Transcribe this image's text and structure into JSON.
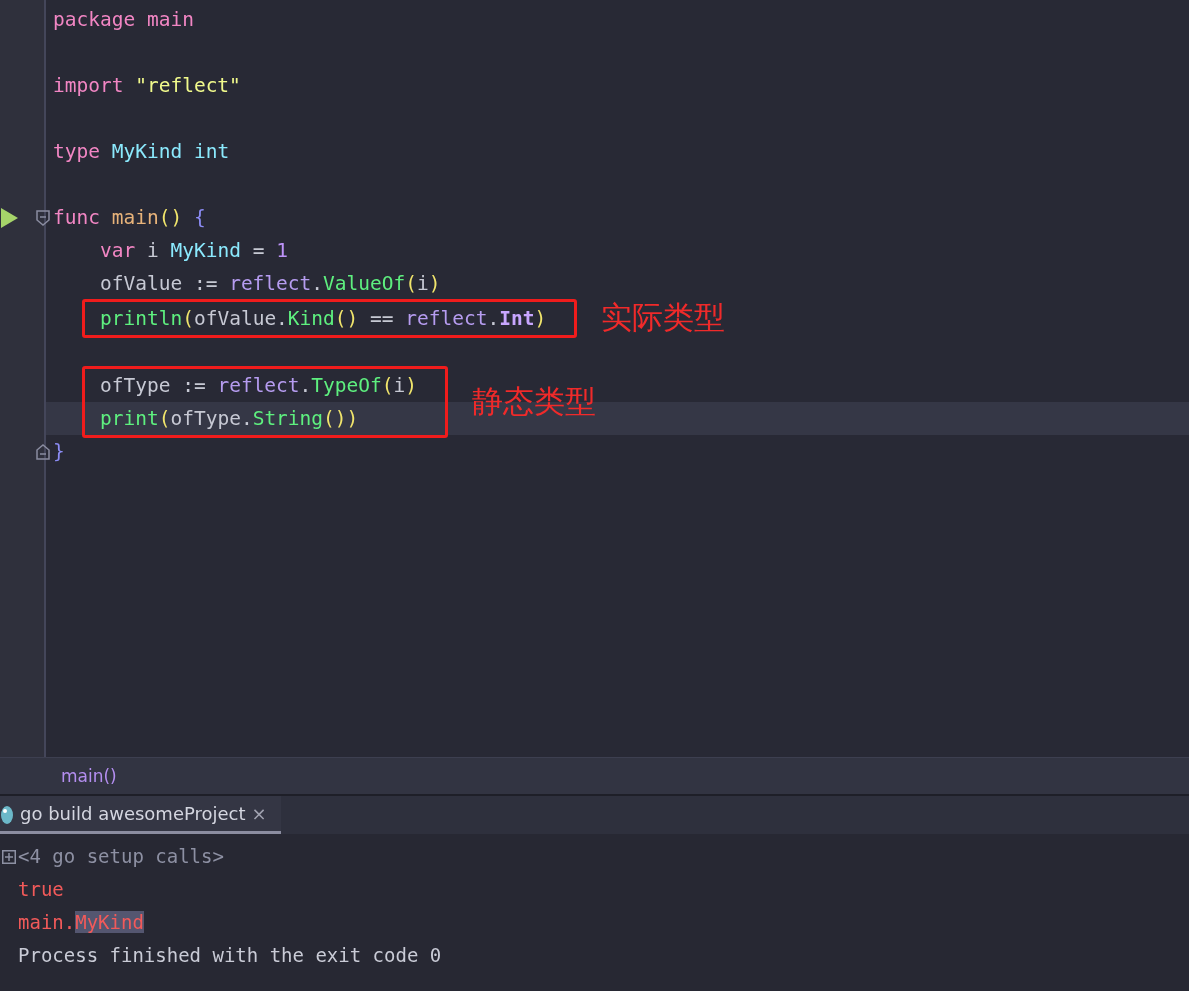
{
  "editor": {
    "lines": [
      {
        "kind": "code",
        "current": false,
        "tokens": [
          {
            "text": "package",
            "kind": "kw"
          },
          {
            "text": " main",
            "kind": "kw"
          }
        ]
      },
      {
        "kind": "blank"
      },
      {
        "kind": "code",
        "current": false,
        "tokens": [
          {
            "text": "import",
            "kind": "kw"
          },
          {
            "text": " \"reflect\"",
            "kind": "str"
          }
        ]
      },
      {
        "kind": "blank"
      },
      {
        "kind": "code",
        "current": false,
        "tokens": [
          {
            "text": "type",
            "kind": "kw"
          },
          {
            "text": " MyKind",
            "kind": "type"
          },
          {
            "text": " int",
            "kind": "type"
          }
        ]
      },
      {
        "kind": "blank"
      },
      {
        "kind": "fold_start",
        "current": false,
        "run_marker": true,
        "tokens": [
          {
            "text": "func",
            "kind": "kw"
          },
          {
            "text": " main",
            "kind": "fn"
          },
          {
            "text": "()",
            "kind": "paren"
          },
          {
            "text": " {",
            "kind": "brace"
          }
        ],
        "children": [
          {
            "kind": "code",
            "current": false,
            "tokens": [
              {
                "text": "var",
                "kind": "kw"
              },
              {
                "text": " i ",
                "kind": "plain"
              },
              {
                "text": "MyKind",
                "kind": "type"
              },
              {
                "text": " = ",
                "kind": "plain"
              },
              {
                "text": "1",
                "kind": "num"
              }
            ]
          },
          {
            "kind": "code",
            "current": false,
            "tokens": [
              {
                "text": "ofValue := ",
                "kind": "plain"
              },
              {
                "text": "reflect",
                "kind": "pkg"
              },
              {
                "text": ".",
                "kind": "plain"
              },
              {
                "text": "ValueOf",
                "kind": "call"
              },
              {
                "text": "(",
                "kind": "paren"
              },
              {
                "text": "i",
                "kind": "plain"
              },
              {
                "text": ")",
                "kind": "paren"
              }
            ]
          },
          {
            "kind": "annotated",
            "label": "实际类型",
            "lines": [
              {
                "kind": "code",
                "current": false,
                "tokens": [
                  {
                    "text": "println",
                    "kind": "call"
                  },
                  {
                    "text": "(",
                    "kind": "paren"
                  },
                  {
                    "text": "ofValue.",
                    "kind": "plain"
                  },
                  {
                    "text": "Kind",
                    "kind": "call"
                  },
                  {
                    "text": "()",
                    "kind": "paren"
                  },
                  {
                    "text": " == ",
                    "kind": "plain"
                  },
                  {
                    "text": "reflect",
                    "kind": "pkg"
                  },
                  {
                    "text": ".",
                    "kind": "plain"
                  },
                  {
                    "text": "Int",
                    "kind": "const"
                  },
                  {
                    "text": ")",
                    "kind": "paren"
                  }
                ]
              }
            ]
          },
          {
            "kind": "blank"
          },
          {
            "kind": "annotated",
            "label": "静态类型",
            "lines": [
              {
                "kind": "code",
                "current": false,
                "tokens": [
                  {
                    "text": "ofType := ",
                    "kind": "plain"
                  },
                  {
                    "text": "reflect",
                    "kind": "pkg"
                  },
                  {
                    "text": ".",
                    "kind": "plain"
                  },
                  {
                    "text": "TypeOf",
                    "kind": "call"
                  },
                  {
                    "text": "(",
                    "kind": "paren"
                  },
                  {
                    "text": "i",
                    "kind": "plain"
                  },
                  {
                    "text": ")",
                    "kind": "paren"
                  }
                ]
              },
              {
                "kind": "code",
                "current": true,
                "tokens": [
                  {
                    "text": "print",
                    "kind": "call"
                  },
                  {
                    "text": "(",
                    "kind": "paren"
                  },
                  {
                    "text": "ofType.",
                    "kind": "plain"
                  },
                  {
                    "text": "String",
                    "kind": "call"
                  },
                  {
                    "text": "())",
                    "kind": "paren"
                  }
                ]
              }
            ]
          }
        ]
      },
      {
        "kind": "fold_end",
        "current": false,
        "tokens": [
          {
            "text": "}",
            "kind": "brace"
          }
        ]
      }
    ]
  },
  "breadcrumb": {
    "items": [
      "main()"
    ]
  },
  "run_panel": {
    "tabs": [
      {
        "label": "go build awesomeProject",
        "selected": true,
        "close": "×"
      }
    ],
    "console": [
      {
        "kind": "fold",
        "parts": [
          {
            "text": "<4 go setup calls>",
            "selected": false
          }
        ]
      },
      {
        "kind": "stderr",
        "parts": [
          {
            "text": "true",
            "selected": false
          }
        ]
      },
      {
        "kind": "stderr",
        "parts": [
          {
            "text": "main.",
            "selected": false
          },
          {
            "text": "MyKind",
            "selected": true
          }
        ]
      },
      {
        "kind": "info",
        "parts": [
          {
            "text": "Process finished with the exit code 0",
            "selected": false
          }
        ]
      }
    ]
  }
}
